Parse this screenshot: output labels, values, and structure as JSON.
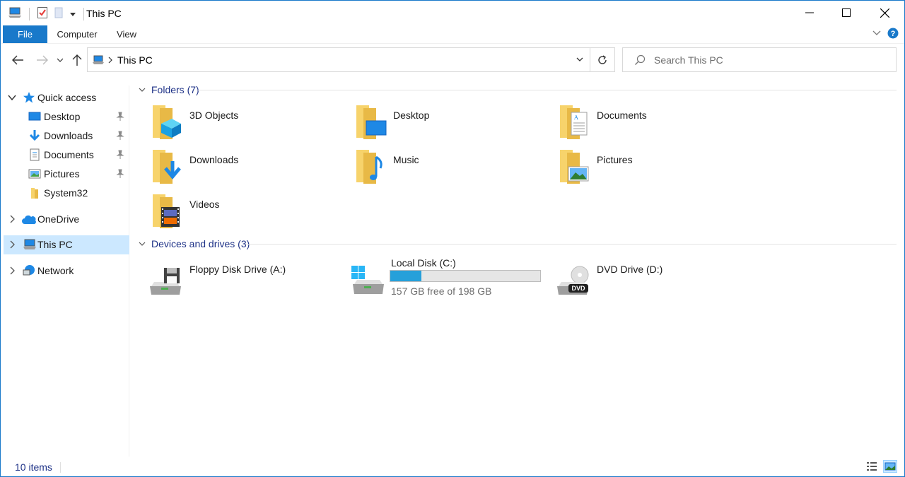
{
  "window": {
    "title": "This PC"
  },
  "ribbon": {
    "tabs": [
      {
        "label": "File"
      },
      {
        "label": "Computer"
      },
      {
        "label": "View"
      }
    ]
  },
  "address": {
    "crumb": "This PC"
  },
  "search": {
    "placeholder": "Search This PC"
  },
  "sidebar": {
    "quick_access": {
      "label": "Quick access"
    },
    "quick_items": [
      {
        "label": "Desktop",
        "icon": "desktop-icon",
        "pinned": true
      },
      {
        "label": "Downloads",
        "icon": "downloads-icon",
        "pinned": true
      },
      {
        "label": "Documents",
        "icon": "documents-icon",
        "pinned": true
      },
      {
        "label": "Pictures",
        "icon": "pictures-icon",
        "pinned": true
      },
      {
        "label": "System32",
        "icon": "folder-icon",
        "pinned": false
      }
    ],
    "onedrive": {
      "label": "OneDrive"
    },
    "thispc": {
      "label": "This PC",
      "selected": true
    },
    "network": {
      "label": "Network"
    }
  },
  "folders": {
    "header": "Folders (7)",
    "items": [
      {
        "name": "3D Objects",
        "icon": "3d-objects-folder-icon"
      },
      {
        "name": "Desktop",
        "icon": "desktop-folder-icon"
      },
      {
        "name": "Documents",
        "icon": "documents-folder-icon"
      },
      {
        "name": "Downloads",
        "icon": "downloads-folder-icon"
      },
      {
        "name": "Music",
        "icon": "music-folder-icon"
      },
      {
        "name": "Pictures",
        "icon": "pictures-folder-icon"
      },
      {
        "name": "Videos",
        "icon": "videos-folder-icon"
      }
    ]
  },
  "devices": {
    "header": "Devices and drives (3)",
    "items": [
      {
        "name": "Floppy Disk Drive (A:)",
        "icon": "floppy-drive-icon"
      },
      {
        "name": "Local Disk (C:)",
        "icon": "local-disk-icon",
        "free_text": "157 GB free of 198 GB",
        "used_fraction": 0.207
      },
      {
        "name": "DVD Drive (D:)",
        "icon": "dvd-drive-icon",
        "badge": "DVD"
      }
    ]
  },
  "status": {
    "items_text": "10 items"
  },
  "colors": {
    "accent": "#1979ca",
    "selection": "#cce8ff",
    "group_header": "#1e3287",
    "bar_fill": "#26a0da",
    "folder_yellow": "#f7d36b"
  }
}
